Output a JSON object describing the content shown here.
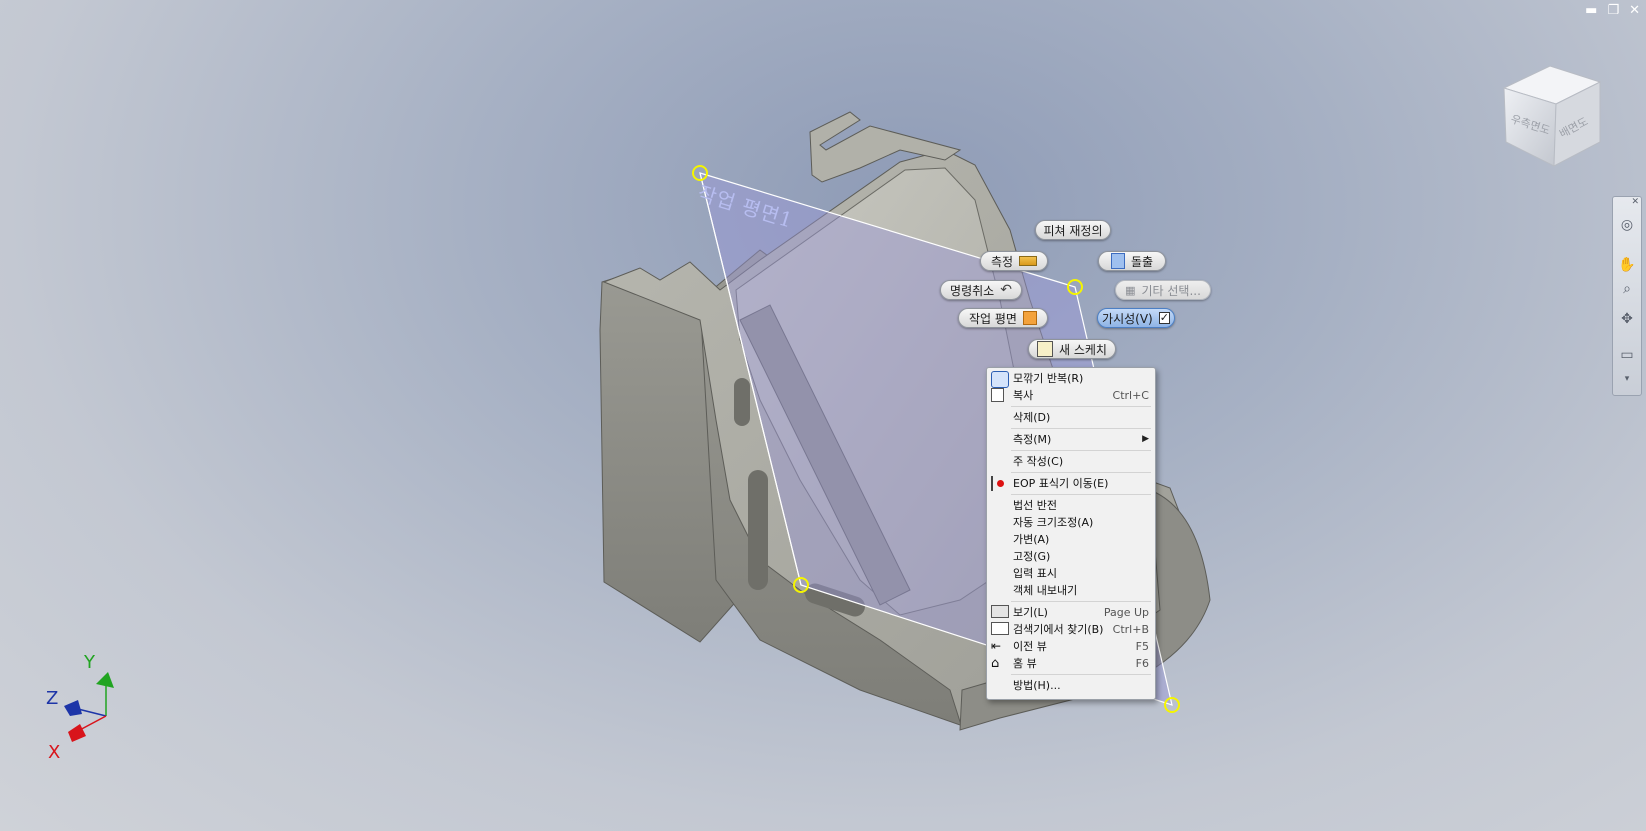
{
  "window_controls": {
    "minimize": "▬",
    "restore": "❐",
    "close": "✕"
  },
  "viewcube": {
    "faces": [
      "우측면도",
      "배면도"
    ]
  },
  "work_plane_label": "작업 평면1",
  "marking_menu": {
    "feature_redefine": "피쳐 재정의",
    "measure": "측정",
    "extrude": "돌출",
    "undo": "명령취소",
    "other_select": "기타 선택...",
    "work_plane": "작업 평면",
    "visibility": "가시성(V)",
    "visibility_checked": true,
    "new_sketch": "새 스케치"
  },
  "context_menu": {
    "items": [
      {
        "label": "모깎기 반복(R)",
        "shortcut": "",
        "icon": "fillet-icon"
      },
      {
        "label": "복사",
        "shortcut": "Ctrl+C",
        "icon": "copy-icon"
      },
      {
        "label": "삭제(D)",
        "shortcut": ""
      },
      {
        "label": "측정(M)",
        "shortcut": "",
        "submenu": true
      },
      {
        "label": "주 작성(C)",
        "shortcut": ""
      },
      {
        "label": "EOP 표식기 이동(E)",
        "shortcut": "",
        "icon": "eop-marker-icon"
      },
      {
        "label": "법선 반전",
        "shortcut": ""
      },
      {
        "label": "자동 크기조정(A)",
        "shortcut": ""
      },
      {
        "label": "가변(A)",
        "shortcut": ""
      },
      {
        "label": "고정(G)",
        "shortcut": ""
      },
      {
        "label": "입력 표시",
        "shortcut": ""
      },
      {
        "label": "객체 내보내기",
        "shortcut": ""
      },
      {
        "label": "보기(L)",
        "shortcut": "Page Up",
        "icon": "view-icon"
      },
      {
        "label": "검색기에서 찾기(B)",
        "shortcut": "Ctrl+B",
        "icon": "find-in-browser-icon"
      },
      {
        "label": "이전 뷰",
        "shortcut": "F5",
        "icon": "previous-view-icon"
      },
      {
        "label": "홈 뷰",
        "shortcut": "F6",
        "icon": "home-view-icon"
      },
      {
        "label": "방법(H)...",
        "shortcut": ""
      }
    ]
  },
  "axis_triad": {
    "x": "X",
    "y": "Y",
    "z": "Z"
  },
  "colors": {
    "plane_fill": "#9a97d6",
    "plane_handle": "#f5f500",
    "part_face": "#8c8c86",
    "axis_x": "#d8141b",
    "axis_y": "#21a421",
    "axis_z": "#1d35a8"
  }
}
